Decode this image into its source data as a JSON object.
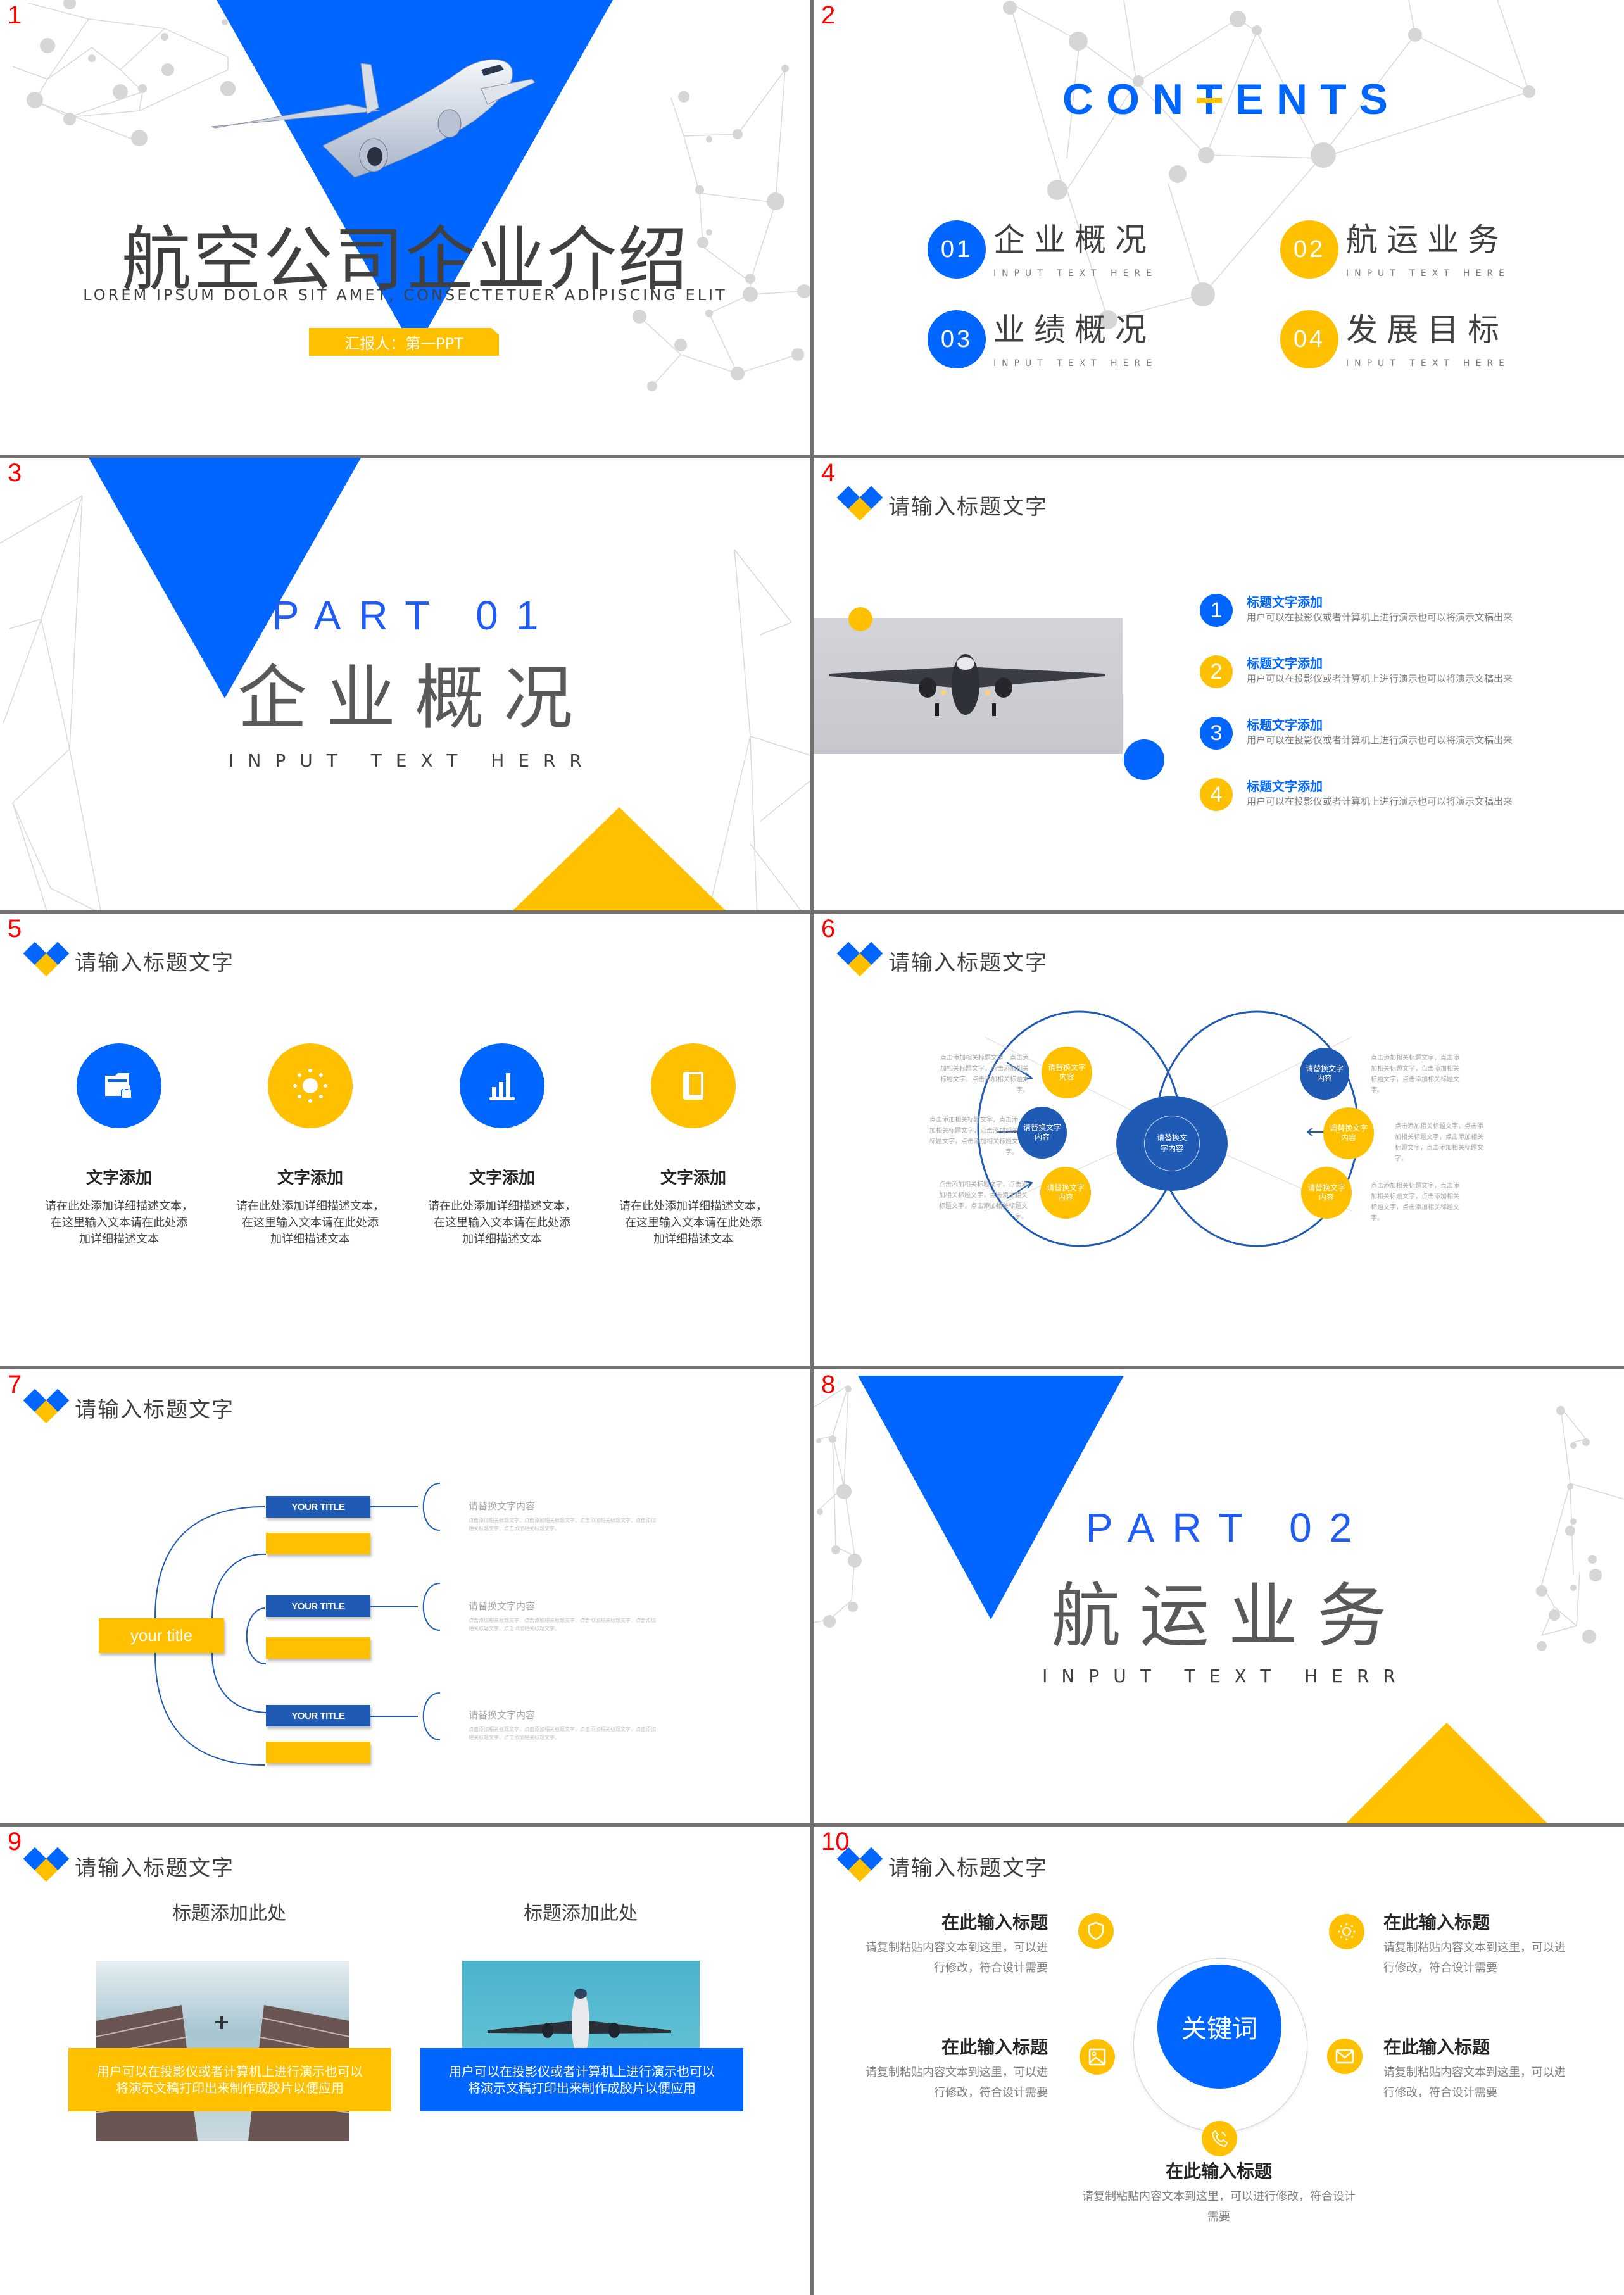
{
  "colors": {
    "blue": "#0066ff",
    "dark_blue": "#1f5bb5",
    "yellow": "#ffc000",
    "gray_text": "#404040",
    "slide_number": "#ff0000"
  },
  "slide_numbers": [
    "1",
    "2",
    "3",
    "4",
    "5",
    "6",
    "7",
    "8",
    "9",
    "10"
  ],
  "header_title": "请输入标题文字",
  "slide1": {
    "title": "航空公司企业介绍",
    "subtitle": "LOREM IPSUM DOLOR SIT AMET, CONSECTETUER ADIPISCING ELIT",
    "reporter": "汇报人：第一PPT"
  },
  "slide2": {
    "heading": "CONTENTS",
    "items": [
      {
        "num": "01",
        "title": "企业概况",
        "en": "INPUT TEXT HERE"
      },
      {
        "num": "02",
        "title": "航运业务",
        "en": "INPUT TEXT HERE"
      },
      {
        "num": "03",
        "title": "业绩概况",
        "en": "INPUT TEXT HERE"
      },
      {
        "num": "04",
        "title": "发展目标",
        "en": "INPUT TEXT HERE"
      }
    ]
  },
  "slide3": {
    "part": "PART 01",
    "title": "企业概况",
    "en": "INPUT TEXT HERR"
  },
  "slide4": {
    "items": [
      {
        "num": "1",
        "title": "标题文字添加",
        "desc": "用户可以在投影仪或者计算机上进行演示也可以将演示文稿出来"
      },
      {
        "num": "2",
        "title": "标题文字添加",
        "desc": "用户可以在投影仪或者计算机上进行演示也可以将演示文稿出来"
      },
      {
        "num": "3",
        "title": "标题文字添加",
        "desc": "用户可以在投影仪或者计算机上进行演示也可以将演示文稿出来"
      },
      {
        "num": "4",
        "title": "标题文字添加",
        "desc": "用户可以在投影仪或者计算机上进行演示也可以将演示文稿出来"
      }
    ]
  },
  "slide5": {
    "features": [
      {
        "icon": "folder-lock-icon",
        "title": "文字添加",
        "desc_lines": [
          "请在此处添加详细描述文本，",
          "在这里输入文本请在此处添",
          "加详细描述文本"
        ]
      },
      {
        "icon": "sun-icon",
        "title": "文字添加",
        "desc_lines": [
          "请在此处添加详细描述文本，",
          "在这里输入文本请在此处添",
          "加详细描述文本"
        ]
      },
      {
        "icon": "bar-chart-icon",
        "title": "文字添加",
        "desc_lines": [
          "请在此处添加详细描述文本，",
          "在这里输入文本请在此处添",
          "加详细描述文本"
        ]
      },
      {
        "icon": "book-icon",
        "title": "文字添加",
        "desc_lines": [
          "请在此处添加详细描述文本，",
          "在这里输入文本请在此处添",
          "加详细描述文本"
        ]
      }
    ]
  },
  "slide6": {
    "center": "请替换文字内容",
    "nodes": [
      "请替换文字内容",
      "请替换文字内容",
      "请替换文字内容",
      "请替换文字内容",
      "请替换文字内容",
      "请替换文字内容"
    ],
    "texts": [
      "点击添加相关标题文字，点击添加相关标题文字，点击添加相关标题文字，点击添加相关标题文字。",
      "点击添加相关标题文字，点击添加相关标题文字，点击添加相关标题文字，点击添加相关标题文字。",
      "点击添加相关标题文字，点击添加相关标题文字，点击添加相关标题文字，点击添加相关标题文字。",
      "点击添加相关标题文字，点击添加相关标题文字，点击添加相关标题文字，点击添加相关标题文字。",
      "点击添加相关标题文字，点击添加相关标题文字，点击添加相关标题文字，点击添加相关标题文字。",
      "点击添加相关标题文字，点击添加相关标题文字，点击添加相关标题文字，点击添加相关标题文字。"
    ]
  },
  "slide7": {
    "root": "your title",
    "branches": [
      "YOUR TITLE",
      "YOUR TITLE",
      "YOUR TITLE"
    ],
    "details": [
      {
        "title": "请替换文字内容",
        "desc": "点击添加相关标题文字，点击添加相关标题文字，点击添加相关标题文字，点击添加相关标题文字，点击添加相关标题文字。"
      },
      {
        "title": "请替换文字内容",
        "desc": "点击添加相关标题文字，点击添加相关标题文字，点击添加相关标题文字，点击添加相关标题文字，点击添加相关标题文字。"
      },
      {
        "title": "请替换文字内容",
        "desc": "点击添加相关标题文字，点击添加相关标题文字，点击添加相关标题文字，点击添加相关标题文字，点击添加相关标题文字。"
      }
    ]
  },
  "slide8": {
    "part": "PART 02",
    "title": "航运业务",
    "en": "INPUT TEXT HERR"
  },
  "slide9": {
    "columns": [
      {
        "title": "标题添加此处",
        "image": "skyscrapers-airplane-photo",
        "text": "用户可以在投影仪或者计算机上进行演示也可以将演示文稿打印出来制作成胶片以便应用"
      },
      {
        "title": "标题添加此处",
        "image": "airplane-sky-photo",
        "text": "用户可以在投影仪或者计算机上进行演示也可以将演示文稿打印出来制作成胶片以便应用"
      }
    ]
  },
  "slide10": {
    "keyword": "关键词",
    "blocks": [
      {
        "icon": "shield-icon",
        "title": "在此输入标题",
        "desc": "请复制粘贴内容文本到这里，可以进行修改，符合设计需要"
      },
      {
        "icon": "sun-icon",
        "title": "在此输入标题",
        "desc": "请复制粘贴内容文本到这里，可以进行修改，符合设计需要"
      },
      {
        "icon": "image-icon",
        "title": "在此输入标题",
        "desc": "请复制粘贴内容文本到这里，可以进行修改，符合设计需要"
      },
      {
        "icon": "mail-icon",
        "title": "在此输入标题",
        "desc": "请复制粘贴内容文本到这里，可以进行修改，符合设计需要"
      },
      {
        "icon": "phone-icon",
        "title": "在此输入标题",
        "desc": "请复制粘贴内容文本到这里，可以进行修改，符合设计需要"
      }
    ]
  }
}
